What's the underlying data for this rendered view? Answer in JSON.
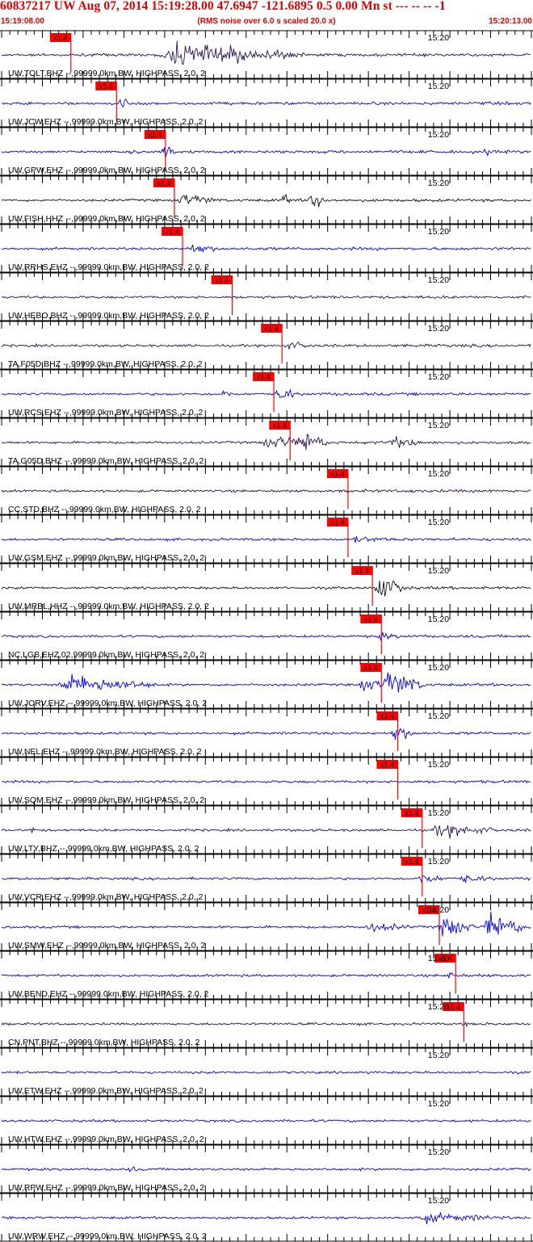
{
  "header": {
    "title": "60837217 UW Aug 07, 2014 15:19:28.00   47.6947 -121.6895  0.5 0.00 Mn st --- -- --  -1",
    "start_time": "15:19:08.00",
    "note": "(RMS noise over 6.0 s scaled 20.0 x)",
    "end_time": "15:20:13.00"
  },
  "colors": {
    "pick": "#ff0000",
    "grid": "#000000",
    "header": "#e00000"
  },
  "chart_data": {
    "type": "seismogram",
    "time_axis": {
      "start": "15:19:08.00",
      "end": "15:20:13.00",
      "minute_mark": "15:20"
    },
    "pick_label": "x1.4",
    "traces": [
      {
        "label": "UW,TOLT,BHZ --,99999.0km,BW, HIGHPASS, 2.0, 2",
        "color": "#2a1050",
        "pick_s": 8.5,
        "events": [
          {
            "t": 19,
            "dur": 20,
            "amp": 24
          },
          {
            "t": 24,
            "dur": 4,
            "amp": 22
          }
        ]
      },
      {
        "label": "UW,JCW,EHZ --,99999.0km,BW, HIGHPASS, 2.0, 2",
        "color": "#0000ee",
        "pick_s": 14.1,
        "events": [
          {
            "t": 14.3,
            "dur": 1.5,
            "amp": 22
          }
        ]
      },
      {
        "label": "UW,GPW,EHZ --,99999.0km,BW, HIGHPASS, 2.0, 2",
        "color": "#0000ee",
        "pick_s": 20.1,
        "events": [
          {
            "t": 15.5,
            "dur": 2,
            "amp": 9
          },
          {
            "t": 19.6,
            "dur": 2,
            "amp": 24
          },
          {
            "t": 59,
            "dur": 2,
            "amp": 10
          }
        ]
      },
      {
        "label": "UW,FISH,HHZ --,99999.0km,BW, HIGHPASS, 2.0, 2",
        "color": "#111111",
        "pick_s": 21.2,
        "events": [
          {
            "t": 21.5,
            "dur": 6,
            "amp": 14
          },
          {
            "t": 34,
            "dur": 2,
            "amp": 15
          },
          {
            "t": 37.5,
            "dur": 3,
            "amp": 22
          }
        ]
      },
      {
        "label": "UW,RRHS,EHZ --,99999.0km,BW, HIGHPASS, 2.0, 2",
        "color": "#0000ee",
        "pick_s": 22.2,
        "events": [
          {
            "t": 22.5,
            "dur": 5,
            "amp": 12
          }
        ]
      },
      {
        "label": "UW,HEBO,BHZ --,99999.0km,BW, HIGHPASS, 2.0, 2",
        "color": "#2a1050",
        "pick_s": 28.3,
        "events": []
      },
      {
        "label": "TA,F05D,BHZ --,99999.0km,BW, HIGHPASS, 2.0, 2",
        "color": "#2a1050",
        "pick_s": 34.4,
        "events": [
          {
            "t": 34.5,
            "dur": 5,
            "amp": 9
          }
        ]
      },
      {
        "label": "UW,RCS,EHZ --,99999.0km,BW, HIGHPASS, 2.0, 2",
        "color": "#0000ee",
        "pick_s": 33.4,
        "events": [
          {
            "t": 27,
            "dur": 1.5,
            "amp": 10
          },
          {
            "t": 33.5,
            "dur": 3,
            "amp": 18
          }
        ]
      },
      {
        "label": "TA,G05D,BHZ --,99999.0km,BW, HIGHPASS, 2.0, 2",
        "color": "#2a1050",
        "pick_s": 35.4,
        "events": [
          {
            "t": 31.5,
            "dur": 10,
            "amp": 14
          },
          {
            "t": 36.5,
            "dur": 4,
            "amp": 26
          },
          {
            "t": 47,
            "dur": 6,
            "amp": 13
          }
        ]
      },
      {
        "label": "CC,STD,BHZ --,99999.0km,BW, HIGHPASS, 2.0, 2",
        "color": "#2a1050",
        "pick_s": 42.5,
        "events": [
          {
            "t": 50,
            "dur": 1.5,
            "amp": 6
          }
        ]
      },
      {
        "label": "UW,GSM,EHZ --,99999.0km,BW, HIGHPASS, 2.0, 2",
        "color": "#0000ee",
        "pick_s": 42.5,
        "events": [
          {
            "t": 42,
            "dur": 9,
            "amp": 7
          }
        ]
      },
      {
        "label": "UW,MRBL,HHZ --,99999.0km,BW, HIGHPASS, 2.0, 2",
        "color": "#111111",
        "pick_s": 45.5,
        "events": [
          {
            "t": 45.5,
            "dur": 5,
            "amp": 26
          }
        ]
      },
      {
        "label": "NC,LGB,EHZ,02,99999.0km,BW, HIGHPASS, 2.0, 2",
        "color": "#0000ee",
        "pick_s": 46.6,
        "events": [
          {
            "t": 46,
            "dur": 4,
            "amp": 8
          }
        ]
      },
      {
        "label": "UW,JORV,EHZ --,99999.0km,BW, HIGHPASS, 2.0, 2",
        "color": "#0000ee",
        "pick_s": 46.6,
        "events": [
          {
            "t": 6.5,
            "dur": 14,
            "amp": 20
          },
          {
            "t": 43.5,
            "dur": 6,
            "amp": 13
          },
          {
            "t": 46.5,
            "dur": 6,
            "amp": 30
          }
        ]
      },
      {
        "label": "UW,NEL,EHZ --,99999.0km,BW, HIGHPASS, 2.0, 2",
        "color": "#0000ee",
        "pick_s": 48.6,
        "events": [
          {
            "t": 47.8,
            "dur": 3,
            "amp": 20
          }
        ]
      },
      {
        "label": "UW,SQM,EHZ --,99999.0km,BW, HIGHPASS, 2.0, 2",
        "color": "#0000ee",
        "pick_s": 48.6,
        "events": []
      },
      {
        "label": "UW,LTY,BHZ --,99999.0km,BW, HIGHPASS, 2.0, 2",
        "color": "#2a1050",
        "pick_s": 51.6,
        "events": [
          {
            "t": 3.5,
            "dur": 0.8,
            "amp": 10
          },
          {
            "t": 52.5,
            "dur": 10,
            "amp": 14
          }
        ]
      },
      {
        "label": "UW,VCR,EHZ --,99999.0km,BW, HIGHPASS, 2.0, 2",
        "color": "#0000ee",
        "pick_s": 51.6,
        "events": [
          {
            "t": 51,
            "dur": 4,
            "amp": 12
          },
          {
            "t": 56,
            "dur": 5,
            "amp": 10
          }
        ]
      },
      {
        "label": "UW,SMW,EHZ --,99999.0km,BW, HIGHPASS, 2.0, 2",
        "color": "#0000ee",
        "pick_s": 53.7,
        "events": [
          {
            "t": 44,
            "dur": 8,
            "amp": 10
          },
          {
            "t": 53.5,
            "dur": 5,
            "amp": 26
          },
          {
            "t": 59,
            "dur": 6,
            "amp": 30
          }
        ]
      },
      {
        "label": "UW,BEND,EHZ --,99999.0km,BW, HIGHPASS, 2.0, 2",
        "color": "#0000ee",
        "pick_s": 55.7,
        "events": [
          {
            "t": 54.5,
            "dur": 1.5,
            "amp": 10
          }
        ]
      },
      {
        "label": "CN,PNT,BHZ --,99999.0km,BW, HIGHPASS, 2.0, 2",
        "color": "#2a1050",
        "pick_s": 56.7,
        "events": [
          {
            "t": 56.5,
            "dur": 2,
            "amp": 5
          }
        ]
      },
      {
        "label": "UW,ETW,EHZ --,99999.0km,BW, HIGHPASS, 2.0, 2",
        "color": "#0000ee",
        "pick_s": null,
        "events": []
      },
      {
        "label": "UW,HTW,EHZ --,99999.0km,BW, HIGHPASS, 2.0, 2",
        "color": "#0000ee",
        "pick_s": null,
        "events": []
      },
      {
        "label": "UW,RPW,EHZ --,99999.0km,BW, HIGHPASS, 2.0, 2",
        "color": "#0000ee",
        "pick_s": null,
        "events": [
          {
            "t": 15.5,
            "dur": 2,
            "amp": 7
          }
        ]
      },
      {
        "label": "UW,WRW,EHZ --,99999.0km,BW, HIGHPASS, 2.0, 2",
        "color": "#0000ee",
        "pick_s": null,
        "events": [
          {
            "t": 50,
            "dur": 15,
            "amp": 10
          }
        ]
      }
    ]
  }
}
